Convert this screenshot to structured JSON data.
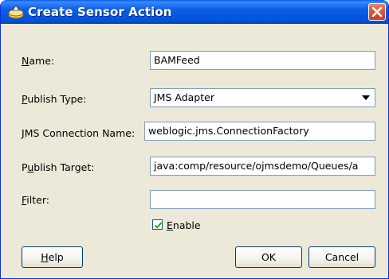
{
  "dialog": {
    "title": "Create Sensor Action",
    "close_icon": "close-icon",
    "title_icon": "sensor-action-icon"
  },
  "form": {
    "name": {
      "label_key": "N",
      "label_rest": "ame:",
      "value": "BAMFeed"
    },
    "publish_type": {
      "label_key": "P",
      "label_rest": "ublish Type:",
      "value": "JMS Adapter"
    },
    "jms_connection": {
      "label_key": "J",
      "label_rest": "MS Connection Name:",
      "value": "weblogic.jms.ConnectionFactory"
    },
    "publish_target": {
      "label_pre": "P",
      "label_key": "u",
      "label_rest": "blish Target:",
      "value": "java:comp/resource/ojmsdemo/Queues/a"
    },
    "filter": {
      "label_key": "F",
      "label_rest": "ilter:",
      "value": ""
    },
    "enable": {
      "label_key": "E",
      "label_rest": "nable",
      "checked": true
    }
  },
  "buttons": {
    "help_key": "H",
    "help_rest": "elp",
    "ok": "OK",
    "cancel": "Cancel"
  }
}
